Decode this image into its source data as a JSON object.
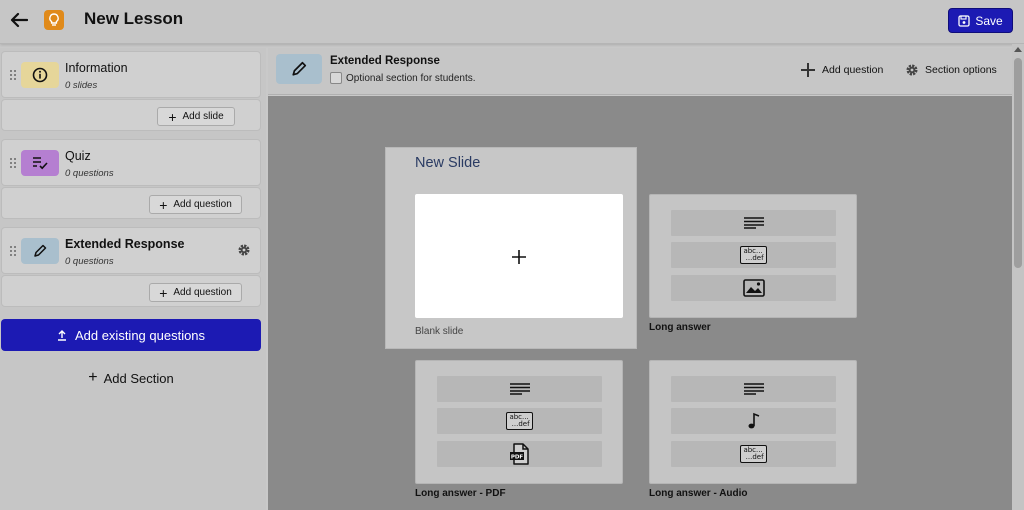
{
  "header": {
    "title": "New Lesson",
    "save_label": "Save"
  },
  "sidebar": {
    "sections": [
      {
        "title": "Information",
        "count": "0 slides",
        "action_label": "Add slide",
        "icon": "info-icon",
        "color": "#e6d69a"
      },
      {
        "title": "Quiz",
        "count": "0 questions",
        "action_label": "Add question",
        "icon": "checklist-icon",
        "color": "#b57fd1"
      },
      {
        "title": "Extended Response",
        "count": "0 questions",
        "action_label": "Add question",
        "icon": "pencil-icon",
        "color": "#a9bfcd"
      }
    ],
    "add_existing_label": "Add existing questions",
    "add_section_label": "Add Section"
  },
  "main": {
    "section_title": "Extended Response",
    "optional_label": "Optional section for students.",
    "add_question_label": "Add question",
    "section_options_label": "Section options"
  },
  "new_slide": {
    "title": "New Slide",
    "blank_label": "Blank slide",
    "templates": [
      {
        "label": "Long answer",
        "rows": [
          "lines-icon",
          "abc-def-icon",
          "image-icon"
        ]
      },
      {
        "label": "Long answer - PDF",
        "rows": [
          "lines-icon",
          "abc-def-icon",
          "pdf-icon"
        ]
      },
      {
        "label": "Long answer - Audio",
        "rows": [
          "lines-icon",
          "music-note-icon",
          "abc-def-icon"
        ]
      }
    ],
    "abc_top": "abc...",
    "abc_bottom": "...def",
    "pdf_text": "PDF"
  },
  "colors": {
    "primary": "#1c1ab3",
    "logo": "#e08a1a"
  }
}
